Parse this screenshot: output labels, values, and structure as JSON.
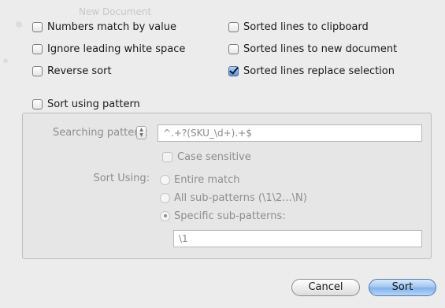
{
  "background": {
    "ghost_text": "New Document"
  },
  "options": {
    "numbers_match": {
      "label": "Numbers match by value",
      "checked": false
    },
    "sorted_to_clipboard": {
      "label": "Sorted lines to clipboard",
      "checked": false
    },
    "ignore_leading_whitespace": {
      "label": "Ignore leading white space",
      "checked": false
    },
    "sorted_to_new_document": {
      "label": "Sorted lines to new document",
      "checked": false
    },
    "reverse_sort": {
      "label": "Reverse sort",
      "checked": false
    },
    "sorted_replace_selection": {
      "label": "Sorted lines replace selection",
      "checked": true
    }
  },
  "sort_using_pattern": {
    "label": "Sort using pattern",
    "checked": false
  },
  "pattern_panel": {
    "searching_pattern_label": "Searching pattern:",
    "searching_pattern_value": "^.+?(SKU_\\d+).+$",
    "case_sensitive": {
      "label": "Case sensitive",
      "checked": false
    },
    "sort_using_label": "Sort Using:",
    "radio_options": [
      {
        "label": "Entire match",
        "selected": false
      },
      {
        "label": "All sub-patterns (\\1\\2...\\N)",
        "selected": false
      },
      {
        "label": "Specific sub-patterns:",
        "selected": true
      }
    ],
    "subpattern_value": "\\1"
  },
  "buttons": {
    "cancel": "Cancel",
    "sort": "Sort"
  },
  "colors": {
    "window_bg": "#ececec",
    "default_button": "#7fb1ea",
    "disabled_text": "#8e8e8e"
  }
}
